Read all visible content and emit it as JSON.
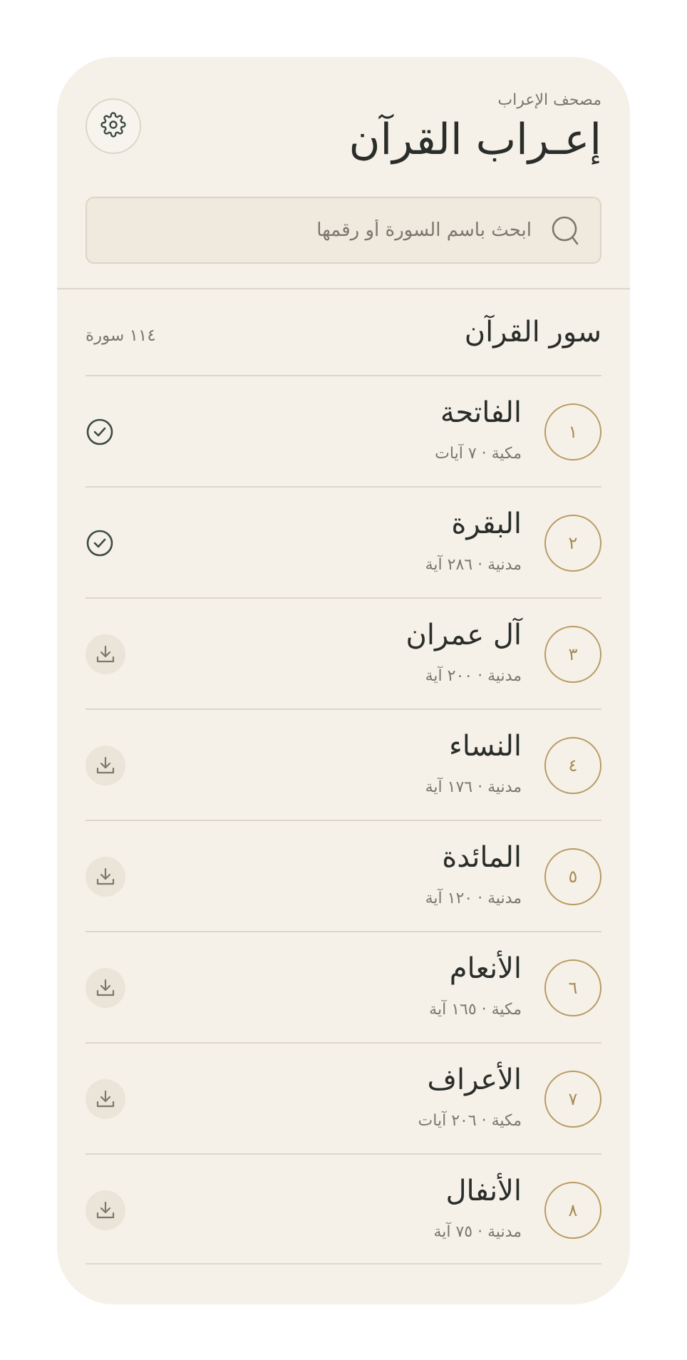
{
  "header": {
    "subtitle": "مصحف الإعراب",
    "title": "إعـراب القرآن",
    "settings_icon": "gear-icon"
  },
  "search": {
    "placeholder": "ابحث باسم السورة أو رقمها",
    "value": "",
    "icon": "search-icon"
  },
  "section": {
    "title": "سور القرآن",
    "count": "١١٤ سورة"
  },
  "surahs": [
    {
      "number": "١",
      "name": "الفاتحة",
      "meta": "مكية · ٧ آيات",
      "status": "downloaded"
    },
    {
      "number": "٢",
      "name": "البقرة",
      "meta": "مدنية · ٢٨٦ آية",
      "status": "downloaded"
    },
    {
      "number": "٣",
      "name": "آل عمران",
      "meta": "مدنية · ٢٠٠ آية",
      "status": "download"
    },
    {
      "number": "٤",
      "name": "النساء",
      "meta": "مدنية · ١٧٦ آية",
      "status": "download"
    },
    {
      "number": "٥",
      "name": "المائدة",
      "meta": "مدنية · ١٢٠ آية",
      "status": "download"
    },
    {
      "number": "٦",
      "name": "الأنعام",
      "meta": "مكية · ١٦٥ آية",
      "status": "download"
    },
    {
      "number": "٧",
      "name": "الأعراف",
      "meta": "مكية · ٢٠٦ آيات",
      "status": "download"
    },
    {
      "number": "٨",
      "name": "الأنفال",
      "meta": "مدنية · ٧٥ آية",
      "status": "download"
    }
  ],
  "colors": {
    "background": "#f5f1e9",
    "accent_gold": "#b99a61",
    "text_dark": "#2a2d29",
    "text_muted": "#7b776f"
  }
}
